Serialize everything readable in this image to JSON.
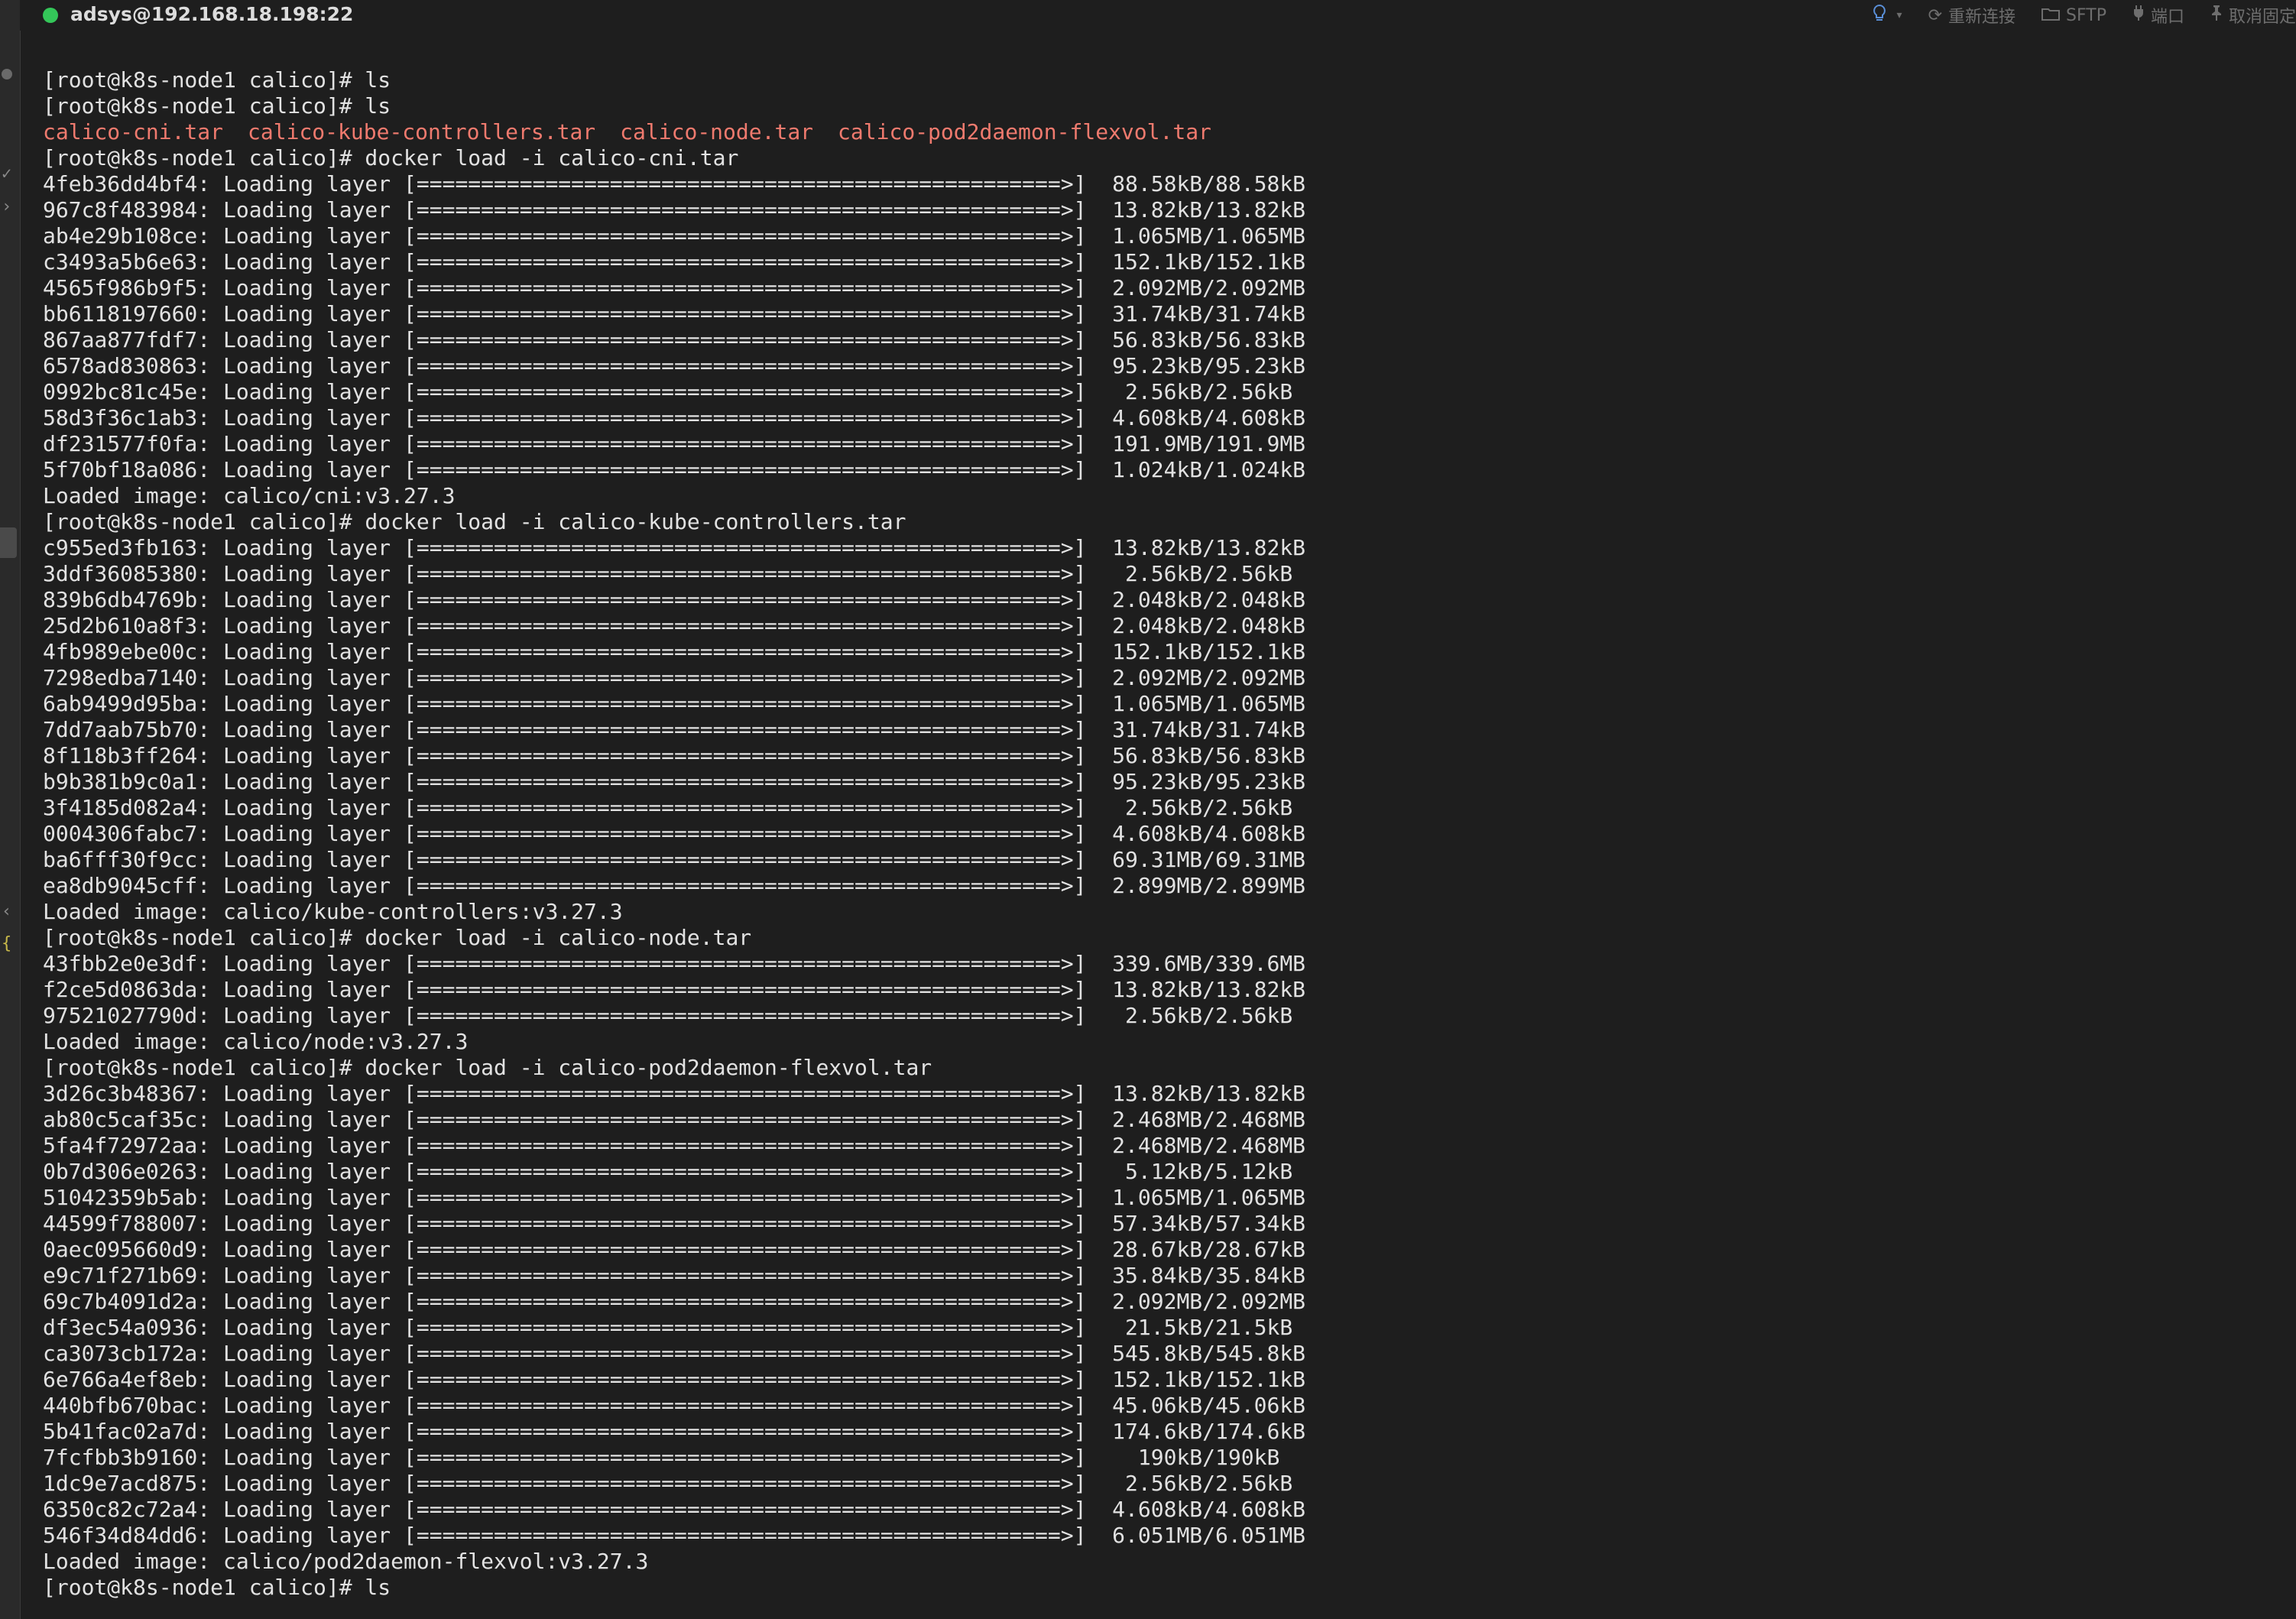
{
  "session": {
    "title": "adsys@192.168.18.198:22",
    "status_color": "#34c759"
  },
  "toolbar": {
    "tip_icon": "lightbulb-icon",
    "reconnect_label": "重新连接",
    "sftp_label": "SFTP",
    "port_label": "端口",
    "unpin_label": "取消固定"
  },
  "terminal": {
    "prompt": "[root@k8s-node1 calico]# ",
    "file_color": "#ef7a6e",
    "ls_files": [
      "calico-cni.tar",
      "calico-kube-controllers.tar",
      "calico-node.tar",
      "calico-pod2daemon-flexvol.tar"
    ],
    "lines": [
      {
        "t": "[root@k8s-node1 calico]# ls"
      },
      {
        "t": "[root@k8s-node1 calico]# ls"
      },
      {
        "type": "ls"
      },
      {
        "t": "[root@k8s-node1 calico]# docker load -i calico-cni.tar"
      },
      {
        "t": "4feb36dd4bf4: Loading layer [==================================================>]  88.58kB/88.58kB"
      },
      {
        "t": "967c8f483984: Loading layer [==================================================>]  13.82kB/13.82kB"
      },
      {
        "t": "ab4e29b108ce: Loading layer [==================================================>]  1.065MB/1.065MB"
      },
      {
        "t": "c3493a5b6e63: Loading layer [==================================================>]  152.1kB/152.1kB"
      },
      {
        "t": "4565f986b9f5: Loading layer [==================================================>]  2.092MB/2.092MB"
      },
      {
        "t": "bb6118197660: Loading layer [==================================================>]  31.74kB/31.74kB"
      },
      {
        "t": "867aa877fdf7: Loading layer [==================================================>]  56.83kB/56.83kB"
      },
      {
        "t": "6578ad830863: Loading layer [==================================================>]  95.23kB/95.23kB"
      },
      {
        "t": "0992bc81c45e: Loading layer [==================================================>]   2.56kB/2.56kB"
      },
      {
        "t": "58d3f36c1ab3: Loading layer [==================================================>]  4.608kB/4.608kB"
      },
      {
        "t": "df231577f0fa: Loading layer [==================================================>]  191.9MB/191.9MB"
      },
      {
        "t": "5f70bf18a086: Loading layer [==================================================>]  1.024kB/1.024kB"
      },
      {
        "t": "Loaded image: calico/cni:v3.27.3"
      },
      {
        "t": "[root@k8s-node1 calico]# docker load -i calico-kube-controllers.tar"
      },
      {
        "t": "c955ed3fb163: Loading layer [==================================================>]  13.82kB/13.82kB"
      },
      {
        "t": "3ddf36085380: Loading layer [==================================================>]   2.56kB/2.56kB"
      },
      {
        "t": "839b6db4769b: Loading layer [==================================================>]  2.048kB/2.048kB"
      },
      {
        "t": "25d2b610a8f3: Loading layer [==================================================>]  2.048kB/2.048kB"
      },
      {
        "t": "4fb989ebe00c: Loading layer [==================================================>]  152.1kB/152.1kB"
      },
      {
        "t": "7298edba7140: Loading layer [==================================================>]  2.092MB/2.092MB"
      },
      {
        "t": "6ab9499d95ba: Loading layer [==================================================>]  1.065MB/1.065MB"
      },
      {
        "t": "7dd7aab75b70: Loading layer [==================================================>]  31.74kB/31.74kB"
      },
      {
        "t": "8f118b3ff264: Loading layer [==================================================>]  56.83kB/56.83kB"
      },
      {
        "t": "b9b381b9c0a1: Loading layer [==================================================>]  95.23kB/95.23kB"
      },
      {
        "t": "3f4185d082a4: Loading layer [==================================================>]   2.56kB/2.56kB"
      },
      {
        "t": "0004306fabc7: Loading layer [==================================================>]  4.608kB/4.608kB"
      },
      {
        "t": "ba6fff30f9cc: Loading layer [==================================================>]  69.31MB/69.31MB"
      },
      {
        "t": "ea8db9045cff: Loading layer [==================================================>]  2.899MB/2.899MB"
      },
      {
        "t": "Loaded image: calico/kube-controllers:v3.27.3"
      },
      {
        "t": "[root@k8s-node1 calico]# docker load -i calico-node.tar"
      },
      {
        "t": "43fbb2e0e3df: Loading layer [==================================================>]  339.6MB/339.6MB"
      },
      {
        "t": "f2ce5d0863da: Loading layer [==================================================>]  13.82kB/13.82kB"
      },
      {
        "t": "97521027790d: Loading layer [==================================================>]   2.56kB/2.56kB"
      },
      {
        "t": "Loaded image: calico/node:v3.27.3"
      },
      {
        "t": "[root@k8s-node1 calico]# docker load -i calico-pod2daemon-flexvol.tar"
      },
      {
        "t": "3d26c3b48367: Loading layer [==================================================>]  13.82kB/13.82kB"
      },
      {
        "t": "ab80c5caf35c: Loading layer [==================================================>]  2.468MB/2.468MB"
      },
      {
        "t": "5fa4f72972aa: Loading layer [==================================================>]  2.468MB/2.468MB"
      },
      {
        "t": "0b7d306e0263: Loading layer [==================================================>]   5.12kB/5.12kB"
      },
      {
        "t": "51042359b5ab: Loading layer [==================================================>]  1.065MB/1.065MB"
      },
      {
        "t": "44599f788007: Loading layer [==================================================>]  57.34kB/57.34kB"
      },
      {
        "t": "0aec095660d9: Loading layer [==================================================>]  28.67kB/28.67kB"
      },
      {
        "t": "e9c71f271b69: Loading layer [==================================================>]  35.84kB/35.84kB"
      },
      {
        "t": "69c7b4091d2a: Loading layer [==================================================>]  2.092MB/2.092MB"
      },
      {
        "t": "df3ec54a0936: Loading layer [==================================================>]   21.5kB/21.5kB"
      },
      {
        "t": "ca3073cb172a: Loading layer [==================================================>]  545.8kB/545.8kB"
      },
      {
        "t": "6e766a4ef8eb: Loading layer [==================================================>]  152.1kB/152.1kB"
      },
      {
        "t": "440bfb670bac: Loading layer [==================================================>]  45.06kB/45.06kB"
      },
      {
        "t": "5b41fac02a7d: Loading layer [==================================================>]  174.6kB/174.6kB"
      },
      {
        "t": "7fcfbb3b9160: Loading layer [==================================================>]    190kB/190kB"
      },
      {
        "t": "1dc9e7acd875: Loading layer [==================================================>]   2.56kB/2.56kB"
      },
      {
        "t": "6350c82c72a4: Loading layer [==================================================>]  4.608kB/4.608kB"
      },
      {
        "t": "546f34d84dd6: Loading layer [==================================================>]  6.051MB/6.051MB"
      },
      {
        "t": "Loaded image: calico/pod2daemon-flexvol:v3.27.3"
      },
      {
        "t": "[root@k8s-node1 calico]# ls"
      }
    ]
  }
}
